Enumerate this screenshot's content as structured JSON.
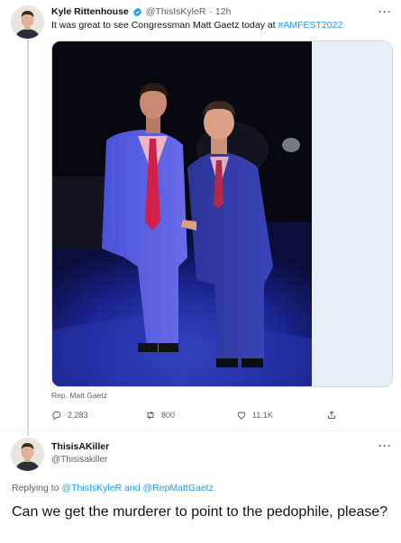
{
  "tweet": {
    "author_name": "Kyle Rittenhouse",
    "author_handle": "@ThisIsKyleR",
    "time": "· 12h",
    "more": "···",
    "text": "It was great to see Congressman Matt Gaetz today at ",
    "hashtag": "#AMFEST2022",
    "media_caption": "Rep. Matt Gaetz",
    "stats": {
      "replies": "2,283",
      "retweets": "800",
      "likes": "11.1K"
    }
  },
  "reply": {
    "author_name": "ThisisAKiller",
    "author_handle": "@Thisisakiller",
    "more": "···",
    "replying_prefix": "Replying to ",
    "mention1": "@ThisIsKyleR",
    "and": " and ",
    "mention2": "@RepMattGaetz",
    "text": "Can we get the murderer to point to the pedophile, please?"
  },
  "colors": {
    "accent": "#1d9bf0",
    "secondary_text": "#536471",
    "verified": "#1d9bf0"
  },
  "icons": [
    "verified-badge-icon",
    "reply-icon",
    "retweet-icon",
    "like-icon",
    "share-icon",
    "more-icon"
  ]
}
